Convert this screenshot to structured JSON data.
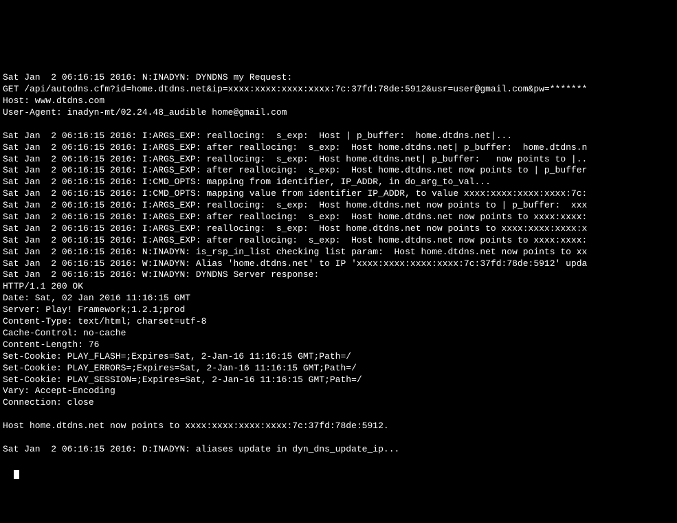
{
  "lines": [
    "Sat Jan  2 06:16:15 2016: N:INADYN: DYNDNS my Request:",
    "GET /api/autodns.cfm?id=home.dtdns.net&ip=xxxx:xxxx:xxxx:xxxx:7c:37fd:78de:5912&usr=user@gmail.com&pw=*******",
    "Host: www.dtdns.com",
    "User-Agent: inadyn-mt/02.24.48_audible home@gmail.com",
    "",
    "Sat Jan  2 06:16:15 2016: I:ARGS_EXP: reallocing:  s_exp:  Host | p_buffer:  home.dtdns.net|...",
    "Sat Jan  2 06:16:15 2016: I:ARGS_EXP: after reallocing:  s_exp:  Host home.dtdns.net| p_buffer:  home.dtdns.n",
    "Sat Jan  2 06:16:15 2016: I:ARGS_EXP: reallocing:  s_exp:  Host home.dtdns.net| p_buffer:   now points to |..",
    "Sat Jan  2 06:16:15 2016: I:ARGS_EXP: after reallocing:  s_exp:  Host home.dtdns.net now points to | p_buffer",
    "Sat Jan  2 06:16:15 2016: I:CMD_OPTS: mapping from identifier, IP_ADDR, in do_arg_to_val...",
    "Sat Jan  2 06:16:15 2016: I:CMD_OPTS: mapping value from identifier IP_ADDR, to value xxxx:xxxx:xxxx:xxxx:7c:",
    "Sat Jan  2 06:16:15 2016: I:ARGS_EXP: reallocing:  s_exp:  Host home.dtdns.net now points to | p_buffer:  xxx",
    "Sat Jan  2 06:16:15 2016: I:ARGS_EXP: after reallocing:  s_exp:  Host home.dtdns.net now points to xxxx:xxxx:",
    "Sat Jan  2 06:16:15 2016: I:ARGS_EXP: reallocing:  s_exp:  Host home.dtdns.net now points to xxxx:xxxx:xxxx:x",
    "Sat Jan  2 06:16:15 2016: I:ARGS_EXP: after reallocing:  s_exp:  Host home.dtdns.net now points to xxxx:xxxx:",
    "Sat Jan  2 06:16:15 2016: N:INADYN: is_rsp_in_list checking list param:  Host home.dtdns.net now points to xx",
    "Sat Jan  2 06:16:15 2016: W:INADYN: Alias 'home.dtdns.net' to IP 'xxxx:xxxx:xxxx:xxxx:7c:37fd:78de:5912' upda",
    "Sat Jan  2 06:16:15 2016: W:INADYN: DYNDNS Server response:",
    "HTTP/1.1 200 OK",
    "Date: Sat, 02 Jan 2016 11:16:15 GMT",
    "Server: Play! Framework;1.2.1;prod",
    "Content-Type: text/html; charset=utf-8",
    "Cache-Control: no-cache",
    "Content-Length: 76",
    "Set-Cookie: PLAY_FLASH=;Expires=Sat, 2-Jan-16 11:16:15 GMT;Path=/",
    "Set-Cookie: PLAY_ERRORS=;Expires=Sat, 2-Jan-16 11:16:15 GMT;Path=/",
    "Set-Cookie: PLAY_SESSION=;Expires=Sat, 2-Jan-16 11:16:15 GMT;Path=/",
    "Vary: Accept-Encoding",
    "Connection: close",
    "",
    "Host home.dtdns.net now points to xxxx:xxxx:xxxx:xxxx:7c:37fd:78de:5912.",
    "",
    "Sat Jan  2 06:16:15 2016: D:INADYN: aliases update in dyn_dns_update_ip..."
  ]
}
